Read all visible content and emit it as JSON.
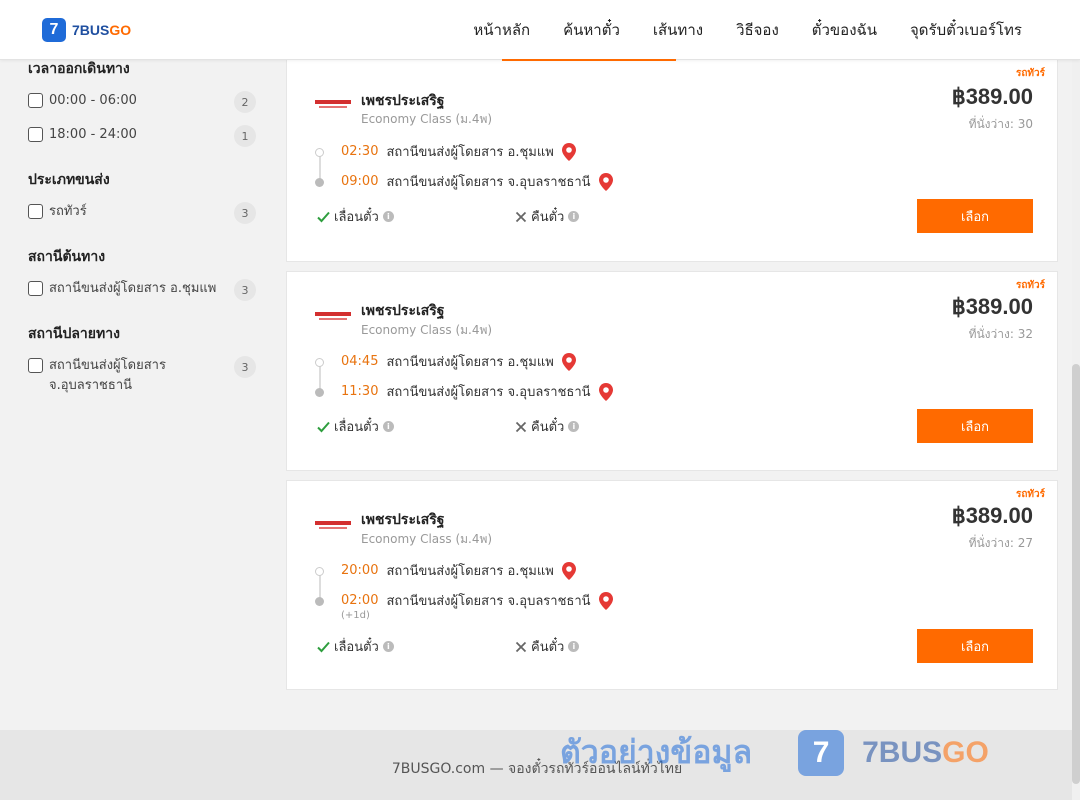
{
  "header": {
    "logo_num": "7",
    "logo_text": "7BUS",
    "logo_go": "GO",
    "nav": [
      "หน้าหลัก",
      "ค้นหาตั๋ว",
      "เส้นทาง",
      "วิธีจอง",
      "ตั๋วของฉัน",
      "จุดรับตั๋วเบอร์โทร"
    ]
  },
  "sidebar": {
    "groups": [
      {
        "title": "เวลาออกเดินทาง",
        "items": [
          {
            "label": "00:00 - 06:00",
            "count": "2"
          },
          {
            "label": "18:00 - 24:00",
            "count": "1"
          }
        ]
      },
      {
        "title": "ประเภทขนส่ง",
        "items": [
          {
            "label": "รถทัวร์",
            "count": "3"
          }
        ]
      },
      {
        "title": "สถานีต้นทาง",
        "items": [
          {
            "label": "สถานีขนส่งผู้โดยสาร อ.ชุมแพ",
            "count": "3"
          }
        ]
      },
      {
        "title": "สถานีปลายทาง",
        "items": [
          {
            "label": "สถานีขนส่งผู้โดยสาร จ.อุบลราชธานี",
            "count": "3"
          }
        ]
      }
    ]
  },
  "trips": [
    {
      "type": "รถทัวร์",
      "operator": "เพชรประเสริฐ",
      "class": "Economy Class (ม.4พ)",
      "dep_time": "02:30",
      "dep_station": "สถานีขนส่งผู้โดยสาร อ.ชุมแพ",
      "arr_time": "09:00",
      "arr_station": "สถานีขนส่งผู้โดยสาร จ.อุบลราชธานี",
      "plus_day": "",
      "postpone": "เลื่อนตั๋ว",
      "refund": "คืนตั๋ว",
      "price": "฿389.00",
      "seats": "ที่นั่งว่าง: 30",
      "button": "เลือก"
    },
    {
      "type": "รถทัวร์",
      "operator": "เพชรประเสริฐ",
      "class": "Economy Class (ม.4พ)",
      "dep_time": "04:45",
      "dep_station": "สถานีขนส่งผู้โดยสาร อ.ชุมแพ",
      "arr_time": "11:30",
      "arr_station": "สถานีขนส่งผู้โดยสาร จ.อุบลราชธานี",
      "plus_day": "",
      "postpone": "เลื่อนตั๋ว",
      "refund": "คืนตั๋ว",
      "price": "฿389.00",
      "seats": "ที่นั่งว่าง: 32",
      "button": "เลือก"
    },
    {
      "type": "รถทัวร์",
      "operator": "เพชรประเสริฐ",
      "class": "Economy Class (ม.4พ)",
      "dep_time": "20:00",
      "dep_station": "สถานีขนส่งผู้โดยสาร อ.ชุมแพ",
      "arr_time": "02:00",
      "arr_station": "สถานีขนส่งผู้โดยสาร จ.อุบลราชธานี",
      "plus_day": "(+1d)",
      "postpone": "เลื่อนตั๋ว",
      "refund": "คืนตั๋ว",
      "price": "฿389.00",
      "seats": "ที่นั่งว่าง: 27",
      "button": "เลือก"
    }
  ],
  "footer": {
    "text": "7BUSGO.com — จองตั๋วรถทัวร์ออนไลน์ทั่วไทย"
  },
  "watermark": {
    "text": "ตัวอย่างข้อมูล",
    "badge": "7",
    "brand": "7BUS",
    "brand_go": "GO"
  },
  "colors": {
    "accent": "#ff6a00",
    "time": "#e8730f",
    "brand_blue": "#1f6bd8",
    "check": "#2e9e3e",
    "pin": "#e53935"
  }
}
